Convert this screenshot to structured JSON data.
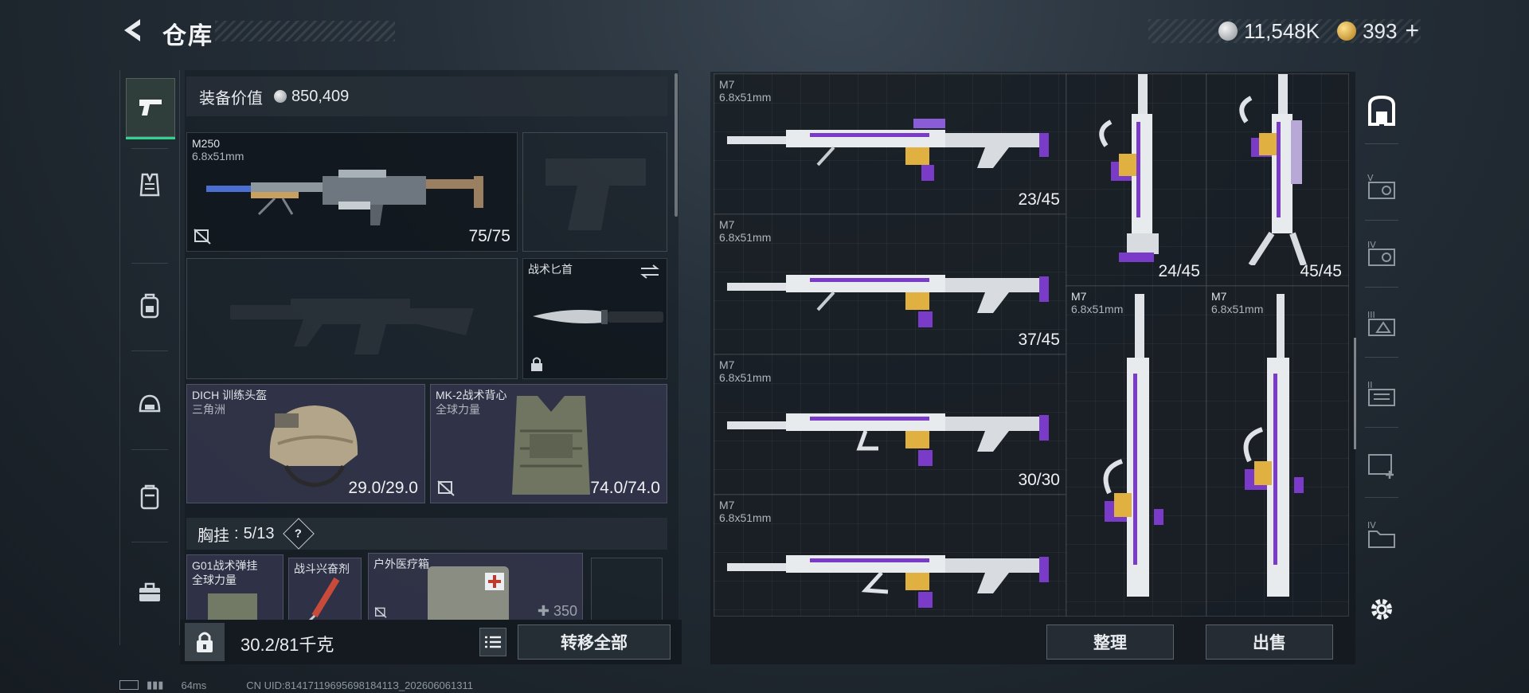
{
  "header": {
    "title": "仓库",
    "currency_silver": "11,548K",
    "currency_gold": "393"
  },
  "left_rail": {
    "items": [
      "weapon",
      "vest",
      "backpack",
      "helmet",
      "case",
      "toolbox"
    ]
  },
  "loadout": {
    "equip_value_label": "装备价值",
    "equip_value": "850,409",
    "primary": {
      "name": "M250",
      "caliber": "6.8x51mm",
      "durability": "75/75"
    },
    "knife": {
      "name": "战术匕首"
    },
    "helmet": {
      "name": "DICH 训练头盔",
      "faction": "三角洲",
      "durability": "29.0/29.0"
    },
    "armor": {
      "name": "MK-2战术背心",
      "faction": "全球力量",
      "durability": "74.0/74.0"
    },
    "chest_rig": {
      "label": "胸挂",
      "separator": ":",
      "count": "5/13",
      "help": "?"
    },
    "chest_items": [
      {
        "name": "G01战术弹挂",
        "sub": "全球力量"
      },
      {
        "name": "战斗兴奋剂"
      },
      {
        "name": "户外医疗箱",
        "count": "350"
      }
    ],
    "weight": "30.2/81千克",
    "transfer_all": "转移全部"
  },
  "stash": {
    "items": [
      {
        "name": "M7",
        "caliber": "6.8x51mm",
        "ammo": "23/45"
      },
      {
        "name": "M7",
        "caliber": "6.8x51mm",
        "ammo": "37/45"
      },
      {
        "name": "M7",
        "caliber": "6.8x51mm",
        "ammo": "30/30"
      },
      {
        "name": "M7",
        "caliber": "6.8x51mm",
        "ammo": ""
      },
      {
        "name": "",
        "caliber": "",
        "ammo": "24/45"
      },
      {
        "name": "",
        "caliber": "",
        "ammo": "45/45"
      },
      {
        "name": "M7",
        "caliber": "6.8x51mm",
        "ammo": ""
      },
      {
        "name": "M7",
        "caliber": "6.8x51mm",
        "ammo": ""
      }
    ],
    "sort_label": "整理",
    "sell_label": "出售"
  },
  "right_rail": {
    "items": [
      "all",
      "V",
      "IV",
      "III",
      "II",
      "add",
      "IV-folder"
    ]
  },
  "status": {
    "latency": "64ms",
    "uid": "CN UID:8141711969569818411З_202606061311"
  },
  "colors": {
    "accent_green": "#2fd58f",
    "purple": "#7a3cc8"
  }
}
